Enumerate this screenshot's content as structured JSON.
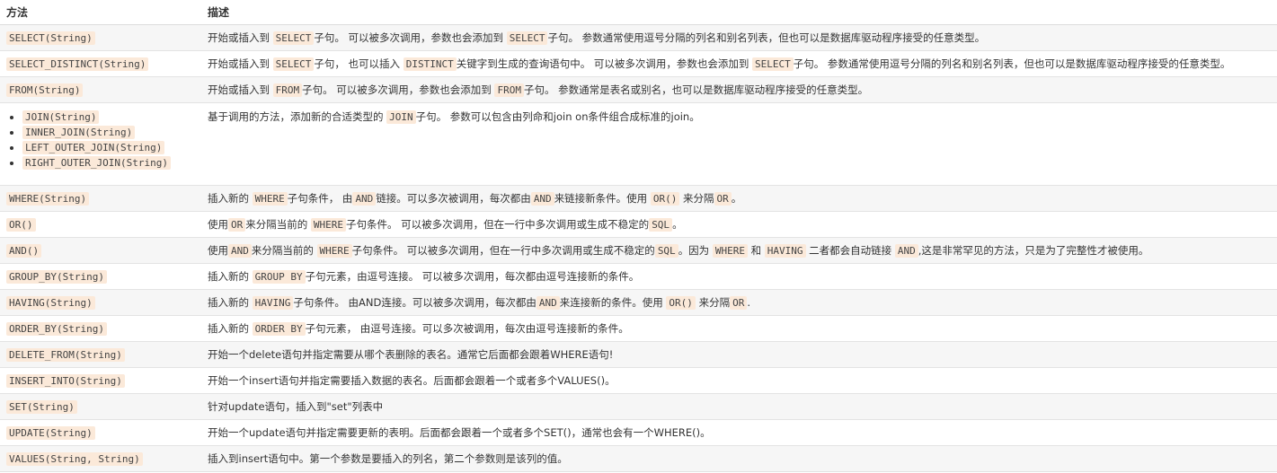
{
  "header": {
    "method": "方法",
    "desc": "描述"
  },
  "rows": [
    {
      "method": "SELECT(String)",
      "desc": [
        {
          "t": "开始或插入到 "
        },
        {
          "c": "SELECT"
        },
        {
          "t": "子句。 可以被多次调用，参数也会添加到 "
        },
        {
          "c": "SELECT"
        },
        {
          "t": "子句。 参数通常使用逗号分隔的列名和别名列表，但也可以是数据库驱动程序接受的任意类型。"
        }
      ]
    },
    {
      "method": "SELECT_DISTINCT(String)",
      "desc": [
        {
          "t": "开始或插入到 "
        },
        {
          "c": "SELECT"
        },
        {
          "t": "子句， 也可以插入 "
        },
        {
          "c": "DISTINCT"
        },
        {
          "t": "关键字到生成的查询语句中。 可以被多次调用，参数也会添加到 "
        },
        {
          "c": "SELECT"
        },
        {
          "t": "子句。 参数通常使用逗号分隔的列名和别名列表，但也可以是数据库驱动程序接受的任意类型。"
        }
      ]
    },
    {
      "method": "FROM(String)",
      "desc": [
        {
          "t": "开始或插入到 "
        },
        {
          "c": "FROM"
        },
        {
          "t": "子句。 可以被多次调用，参数也会添加到 "
        },
        {
          "c": "FROM"
        },
        {
          "t": "子句。 参数通常是表名或别名，也可以是数据库驱动程序接受的任意类型。"
        }
      ]
    },
    {
      "methods": [
        "JOIN(String)",
        "INNER_JOIN(String)",
        "LEFT_OUTER_JOIN(String)",
        "RIGHT_OUTER_JOIN(String)"
      ],
      "desc": [
        {
          "t": "基于调用的方法，添加新的合适类型的 "
        },
        {
          "c": "JOIN"
        },
        {
          "t": "子句。 参数可以包含由列命和join on条件组合成标准的join。"
        }
      ]
    },
    {
      "method": "WHERE(String)",
      "desc": [
        {
          "t": "插入新的 "
        },
        {
          "c": "WHERE"
        },
        {
          "t": "子句条件， 由"
        },
        {
          "c": "AND"
        },
        {
          "t": "链接。可以多次被调用，每次都由"
        },
        {
          "c": "AND"
        },
        {
          "t": "来链接新条件。使用 "
        },
        {
          "c": "OR()"
        },
        {
          "t": " 来分隔"
        },
        {
          "c": "OR"
        },
        {
          "t": "。"
        }
      ]
    },
    {
      "method": "OR()",
      "desc": [
        {
          "t": "使用"
        },
        {
          "c": "OR"
        },
        {
          "t": "来分隔当前的 "
        },
        {
          "c": "WHERE"
        },
        {
          "t": "子句条件。 可以被多次调用，但在一行中多次调用或生成不稳定的"
        },
        {
          "c": "SQL"
        },
        {
          "t": "。"
        }
      ]
    },
    {
      "method": "AND()",
      "desc": [
        {
          "t": "使用"
        },
        {
          "c": "AND"
        },
        {
          "t": "来分隔当前的 "
        },
        {
          "c": "WHERE"
        },
        {
          "t": "子句条件。 可以被多次调用，但在一行中多次调用或生成不稳定的"
        },
        {
          "c": "SQL"
        },
        {
          "t": "。因为 "
        },
        {
          "c": "WHERE"
        },
        {
          "t": " 和 "
        },
        {
          "c": "HAVING"
        },
        {
          "t": " 二者都会自动链接 "
        },
        {
          "c": "AND"
        },
        {
          "t": ",这是非常罕见的方法，只是为了完整性才被使用。"
        }
      ]
    },
    {
      "method": "GROUP_BY(String)",
      "desc": [
        {
          "t": "插入新的 "
        },
        {
          "c": "GROUP BY"
        },
        {
          "t": "子句元素，由逗号连接。 可以被多次调用，每次都由逗号连接新的条件。"
        }
      ]
    },
    {
      "method": "HAVING(String)",
      "desc": [
        {
          "t": "插入新的 "
        },
        {
          "c": "HAVING"
        },
        {
          "t": "子句条件。 由AND连接。可以被多次调用，每次都由"
        },
        {
          "c": "AND"
        },
        {
          "t": "来连接新的条件。使用 "
        },
        {
          "c": "OR()"
        },
        {
          "t": " 来分隔"
        },
        {
          "c": "OR"
        },
        {
          "t": "."
        }
      ]
    },
    {
      "method": "ORDER_BY(String)",
      "desc": [
        {
          "t": "插入新的 "
        },
        {
          "c": "ORDER BY"
        },
        {
          "t": "子句元素， 由逗号连接。可以多次被调用，每次由逗号连接新的条件。"
        }
      ]
    },
    {
      "method": "DELETE_FROM(String)",
      "desc": [
        {
          "t": "开始一个delete语句并指定需要从哪个表删除的表名。通常它后面都会跟着WHERE语句!"
        }
      ]
    },
    {
      "method": "INSERT_INTO(String)",
      "desc": [
        {
          "t": "开始一个insert语句并指定需要插入数据的表名。后面都会跟着一个或者多个VALUES()。"
        }
      ]
    },
    {
      "method": "SET(String)",
      "desc": [
        {
          "t": "针对update语句，插入到\"set\"列表中"
        }
      ]
    },
    {
      "method": "UPDATE(String)",
      "desc": [
        {
          "t": "开始一个update语句并指定需要更新的表明。后面都会跟着一个或者多个SET()，通常也会有一个WHERE()。"
        }
      ]
    },
    {
      "method": "VALUES(String, String)",
      "desc": [
        {
          "t": "插入到insert语句中。第一个参数是要插入的列名，第二个参数则是该列的值。"
        }
      ]
    }
  ]
}
